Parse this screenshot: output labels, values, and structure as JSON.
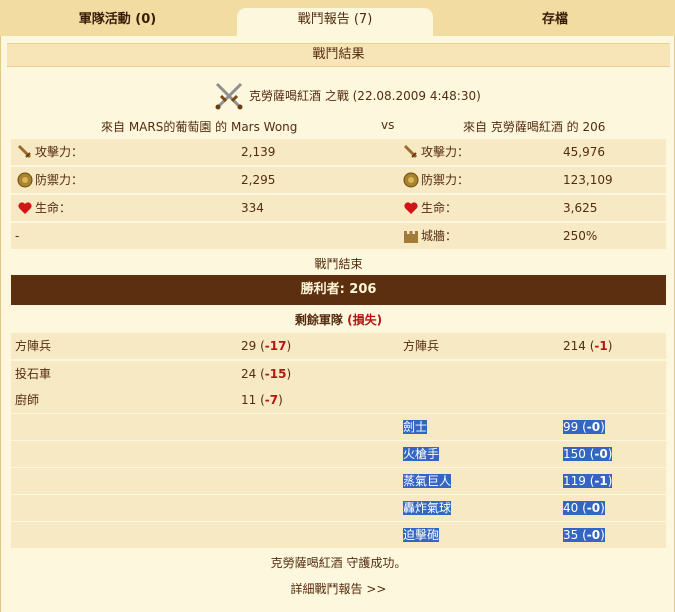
{
  "tabs": [
    {
      "label": "軍隊活動 (0)"
    },
    {
      "label": "戰鬥報告 (7)"
    },
    {
      "label": "存檔"
    }
  ],
  "section_title": "戰鬥結果",
  "battle_title": "克勞薩喝紅酒 之戰 (22.08.2009 4:48:30)",
  "attacker_name": "來自 MARS的葡萄園 的 Mars Wong",
  "vs": "vs",
  "defender_name": "來自 克勞薩喝紅酒 的 206",
  "stats": {
    "attack_label": "攻擊力：",
    "defense_label": "防禦力：",
    "life_label": "生命：",
    "wall_label": "城牆：",
    "attacker": {
      "attack": "2,139",
      "defense": "2,295",
      "life": "334",
      "wall": "-"
    },
    "defender": {
      "attack": "45,976",
      "defense": "123,109",
      "life": "3,625",
      "wall": "250%"
    }
  },
  "battle_end": "戰鬥結束",
  "winner_text": "勝利者: 206",
  "remaining_label": "剩餘軍隊",
  "loss_label": "(損失)",
  "attacker_units": [
    {
      "name": "方陣兵",
      "count": "29",
      "loss": "-17"
    },
    {
      "name": "投石車",
      "count": "24",
      "loss": "-15"
    },
    {
      "name": "廚師",
      "count": "11",
      "loss": "-7"
    }
  ],
  "defender_units": [
    {
      "name": "方陣兵",
      "count": "214",
      "loss": "-1"
    },
    {
      "name": "劍士",
      "count": "99",
      "loss": "-0"
    },
    {
      "name": "火槍手",
      "count": "150",
      "loss": "-0"
    },
    {
      "name": "蒸氣巨人",
      "count": "119",
      "loss": "-1"
    },
    {
      "name": "轟炸氣球",
      "count": "40",
      "loss": "-0"
    },
    {
      "name": "迫擊砲",
      "count": "35",
      "loss": "-0"
    }
  ],
  "result_text": "克勞薩喝紅酒 守護成功。",
  "detail_link": "詳細戰鬥報告 >>",
  "colors": {
    "accent": "#5c2f10",
    "loss": "#b51515",
    "row_bg": "#f7e9c3",
    "selection": "#3266c2"
  }
}
